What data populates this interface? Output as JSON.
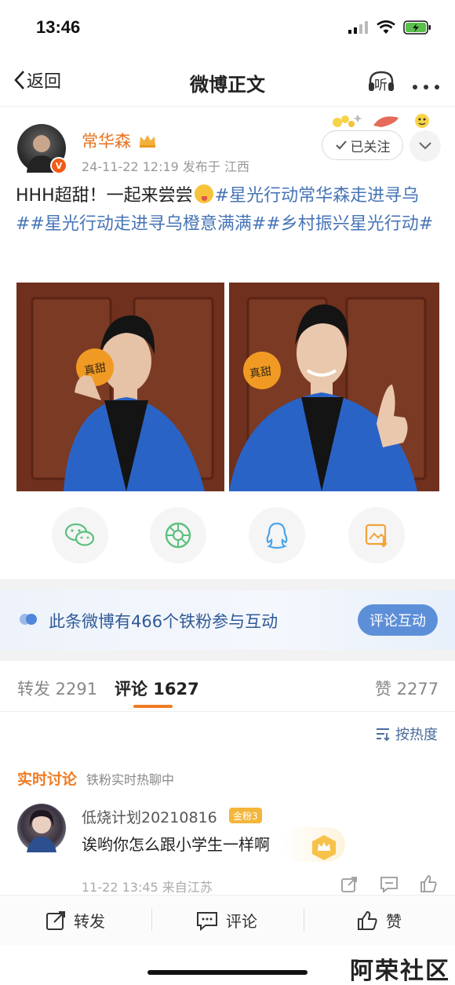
{
  "status_bar": {
    "time": "13:46"
  },
  "nav": {
    "back_label": "返回",
    "title": "微博正文",
    "listen_label": "听"
  },
  "post": {
    "author": "常华森",
    "meta": "24-11-22 12:19  发布于 江西",
    "follow_label": "已关注",
    "content_prefix": "HHH超甜！一起来尝尝",
    "content_tags": "#星光行动常华森走进寻乌##星光行动走进寻乌橙意满满##乡村振兴星光行动#",
    "photo_texts": [
      "真甜",
      "真甜"
    ]
  },
  "share_icons": [
    "wechat-icon",
    "moments-icon",
    "qq-icon",
    "save-image-icon"
  ],
  "fan_banner": {
    "text": "此条微博有466个铁粉参与互动",
    "button": "评论互动"
  },
  "tabs": {
    "repost": "转发 2291",
    "comment": "评论 1627",
    "like": "赞 2277"
  },
  "sort_label": "按热度",
  "live": {
    "title": "实时讨论",
    "subtitle": "铁粉实时热聊中"
  },
  "comment": {
    "name": "低烧计划20210816",
    "badge": "金粉3",
    "text": "诶哟你怎么跟小学生一样啊",
    "time": "11-22 13:45  来自江苏"
  },
  "bottom_bar": {
    "repost": "转发",
    "comment": "评论",
    "like": "赞"
  },
  "watermark": "阿荣社区",
  "colors": {
    "accent": "#f07b22",
    "link": "#4774b6",
    "author": "#e8731e"
  }
}
